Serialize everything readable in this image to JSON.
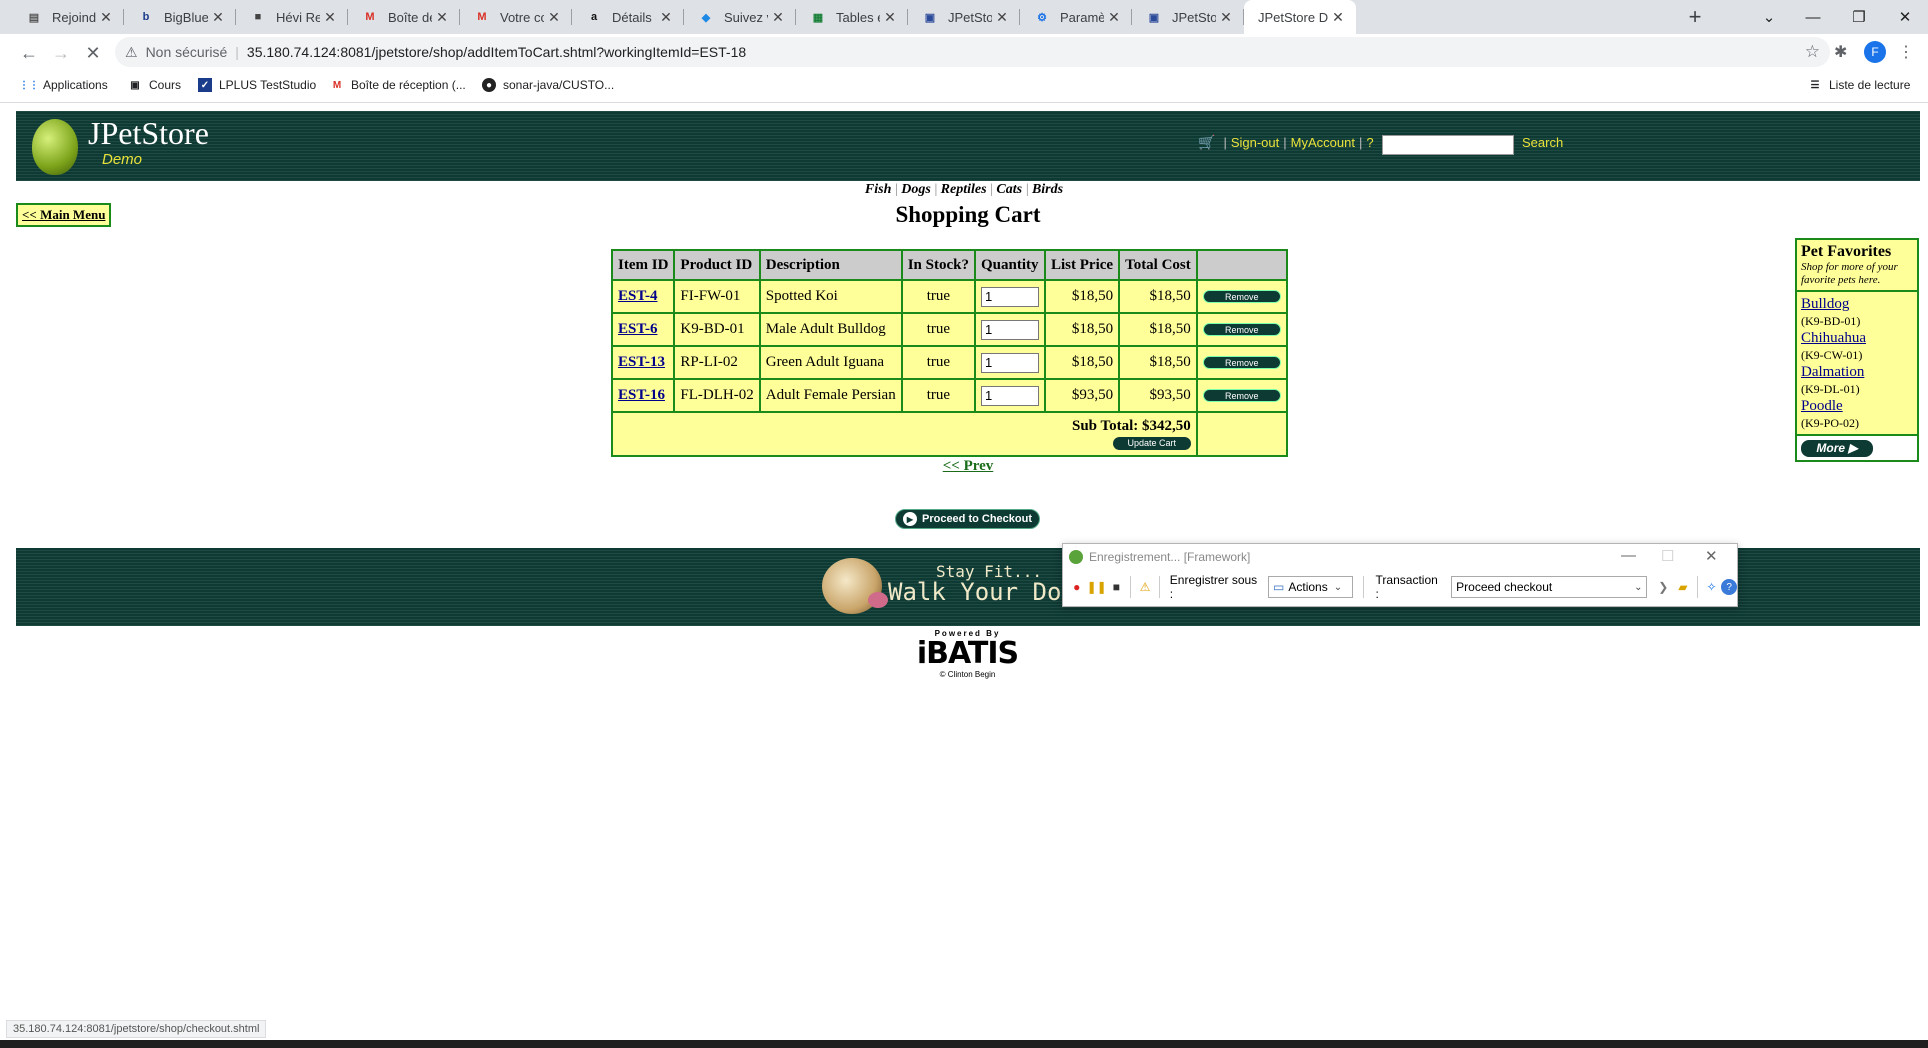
{
  "browser": {
    "tabs": [
      {
        "title": "Rejoindre la s",
        "icon": "doc"
      },
      {
        "title": "BigBlueBu",
        "icon": "bbb"
      },
      {
        "title": "Hévi Restaura",
        "icon": "box"
      },
      {
        "title": "Boîte de récep",
        "icon": "gmail"
      },
      {
        "title": "Votre comma",
        "icon": "gmail"
      },
      {
        "title": "Détails de la c",
        "icon": "amazon"
      },
      {
        "title": "Suivez votre",
        "icon": "cube"
      },
      {
        "title": "Tables et bure",
        "icon": "sheet"
      },
      {
        "title": "JPetStore Den",
        "icon": "page"
      },
      {
        "title": "Paramètres",
        "icon": "gear"
      },
      {
        "title": "JPetStore Den",
        "icon": "page"
      },
      {
        "title": "JPetStore Den",
        "icon": "none",
        "active": true
      }
    ],
    "not_secure": "Non sécurisé",
    "url": "35.180.74.124:8081/jpetstore/shop/addItemToCart.shtml?workingItemId=EST-18",
    "profile_initial": "F",
    "bookmarks": [
      "Applications",
      "Cours",
      "LPLUS TestStudio",
      "Boîte de réception (...",
      "sonar-java/CUSTO..."
    ],
    "reading_list": "Liste de lecture",
    "status_url": "35.180.74.124:8081/jpetstore/shop/checkout.shtml"
  },
  "header": {
    "logo": "JPetStore",
    "logo_sub": "Demo",
    "signout": "Sign-out",
    "myaccount": "MyAccount",
    "help": "?",
    "search_label": "Search",
    "search_value": ""
  },
  "categories": [
    "Fish",
    "Dogs",
    "Reptiles",
    "Cats",
    "Birds"
  ],
  "main_menu": "<< Main Menu",
  "page_title": "Shopping Cart",
  "cart": {
    "columns": [
      "Item ID",
      "Product ID",
      "Description",
      "In Stock?",
      "Quantity",
      "List Price",
      "Total Cost",
      ""
    ],
    "rows": [
      {
        "item_id": "EST-4",
        "product_id": "FI-FW-01",
        "description": "Spotted Koi",
        "in_stock": "true",
        "quantity": "1",
        "list_price": "$18,50",
        "total": "$18,50",
        "remove": "Remove"
      },
      {
        "item_id": "EST-6",
        "product_id": "K9-BD-01",
        "description": "Male Adult Bulldog",
        "in_stock": "true",
        "quantity": "1",
        "list_price": "$18,50",
        "total": "$18,50",
        "remove": "Remove"
      },
      {
        "item_id": "EST-13",
        "product_id": "RP-LI-02",
        "description": "Green Adult Iguana",
        "in_stock": "true",
        "quantity": "1",
        "list_price": "$18,50",
        "total": "$18,50",
        "remove": "Remove"
      },
      {
        "item_id": "EST-16",
        "product_id": "FL-DLH-02",
        "description": "Adult Female Persian",
        "in_stock": "true",
        "quantity": "1",
        "list_price": "$93,50",
        "total": "$93,50",
        "remove": "Remove"
      }
    ],
    "subtotal": "Sub Total: $342,50",
    "update": "Update Cart"
  },
  "prev": "<< Prev",
  "checkout": "Proceed to Checkout",
  "favorites": {
    "title": "Pet Favorites",
    "subtitle": "Shop for more of your favorite pets here.",
    "pets": [
      {
        "name": "Bulldog",
        "code": "(K9-BD-01)"
      },
      {
        "name": "Chihuahua",
        "code": "(K9-CW-01)"
      },
      {
        "name": "Dalmation",
        "code": "(K9-DL-01)"
      },
      {
        "name": "Poodle",
        "code": "(K9-PO-02)"
      }
    ],
    "more": "More"
  },
  "banner": {
    "line1": "Stay Fit...",
    "line2": "Walk Your Dog"
  },
  "footer": {
    "powered": "Powered By",
    "brand": "iBATIS",
    "credit": "© Clinton Begin"
  },
  "recorder": {
    "title": "Enregistrement... [Framework]",
    "save_as": "Enregistrer sous :",
    "actions": "Actions",
    "transaction_label": "Transaction :",
    "transaction_value": "Proceed checkout"
  }
}
